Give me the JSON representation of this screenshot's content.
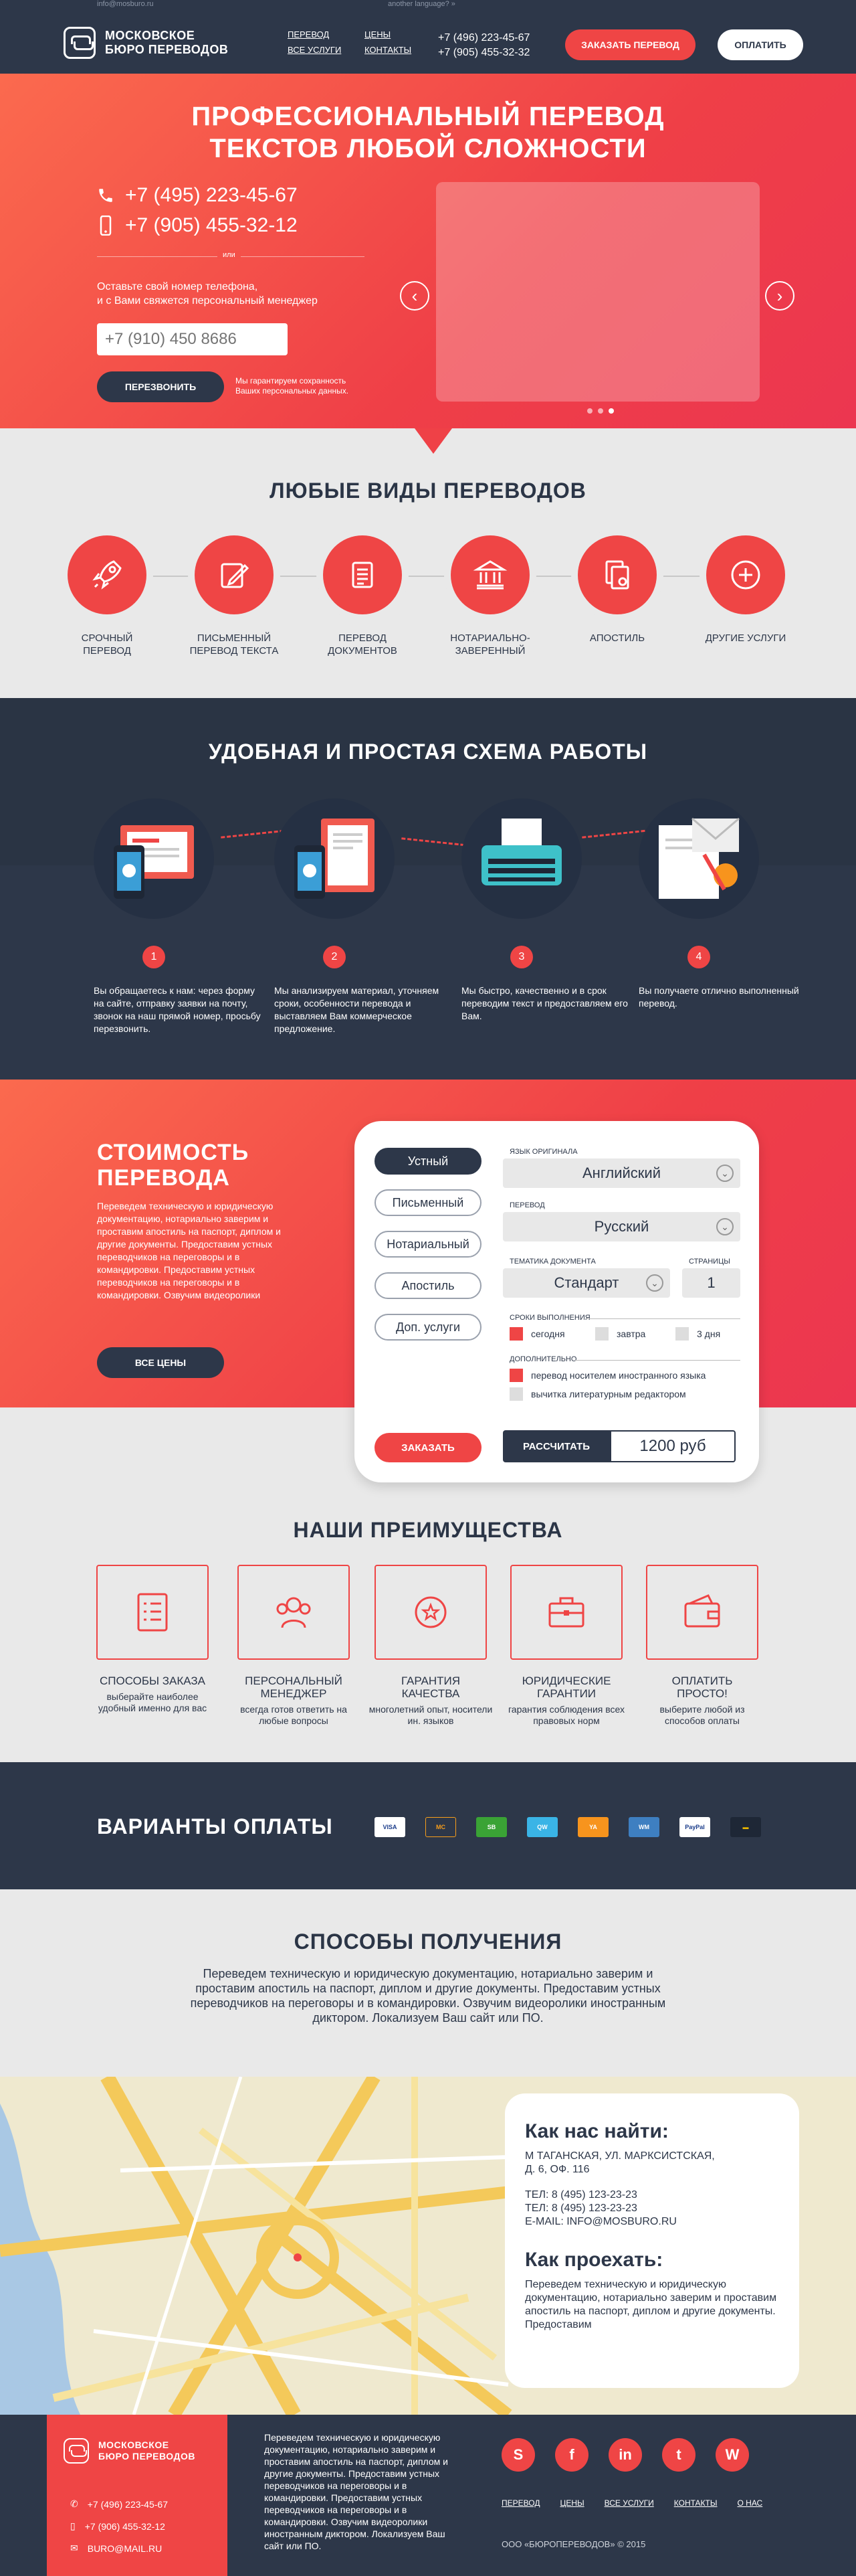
{
  "header": {
    "top_email": "info@mosburo.ru",
    "top_lang": "another language? »",
    "logo_line1": "МОСКОВСКОЕ",
    "logo_line2": "БЮРО ПЕРЕВОДОВ",
    "nav": [
      "ПЕРЕВОД",
      "ЦЕНЫ",
      "ВСЕ УСЛУГИ",
      "КОНТАКТЫ"
    ],
    "phone1": "+7 (496) 223-45-67",
    "phone2": "+7 (905) 455-32-32",
    "order_button": "ЗАКАЗАТЬ ПЕРЕВОД",
    "pay_button": "ОПЛАТИТЬ"
  },
  "hero": {
    "title_line1": "ПРОФЕССИОНАЛЬНЫЙ ПЕРЕВОД",
    "title_line2": "ТЕКСТОВ ЛЮБОЙ СЛОЖНОСТИ",
    "phone1": "+7 (495) 223-45-67",
    "phone2": "+7 (905) 455-32-12",
    "or_label": "или",
    "note_line1": "Оставьте свой номер телефона,",
    "note_line2": "и с Вами свяжется персональный менеджер",
    "phone_placeholder": "+7 (910) 450 8686",
    "call_button": "ПЕРЕЗВОНИТЬ",
    "privacy_line1": "Мы гарантируем сохранность",
    "privacy_line2": "Ваших персональных данных."
  },
  "services": {
    "title": "ЛЮБЫЕ ВИДЫ ПЕРЕВОДОВ",
    "items": [
      {
        "l1": "СРОЧНЫЙ",
        "l2": "ПЕРЕВОД",
        "icon": "rocket-icon"
      },
      {
        "l1": "ПИСЬМЕННЫЙ",
        "l2": "ПЕРЕВОД ТЕКСТА",
        "icon": "pen-document-icon"
      },
      {
        "l1": "ПЕРЕВОД",
        "l2": "ДОКУМЕНТОВ",
        "icon": "document-icon"
      },
      {
        "l1": "НОТАРИАЛЬНО-",
        "l2": "ЗАВЕРЕННЫЙ",
        "icon": "courthouse-icon"
      },
      {
        "l1": "АПОСТИЛЬ",
        "l2": "",
        "icon": "stamped-papers-icon"
      },
      {
        "l1": "ДРУГИЕ УСЛУГИ",
        "l2": "",
        "icon": "plus-circle-icon"
      }
    ]
  },
  "scheme": {
    "title": "УДОБНАЯ И ПРОСТАЯ СХЕМА РАБОТЫ",
    "steps": [
      {
        "num": "1",
        "text": "Вы обращаетесь к нам: через форму на сайте, отправку заявки на почту, звонок на наш прямой номер, просьбу перезвонить."
      },
      {
        "num": "2",
        "text": "Мы анализируем материал, уточняем сроки, особенности перевода и выставляем Вам коммерческое предложение."
      },
      {
        "num": "3",
        "text": "Мы быстро, качественно и в срок переводим текст и предоставляем его Вам."
      },
      {
        "num": "4",
        "text": "Вы получаете отлично выполненный перевод."
      }
    ]
  },
  "price": {
    "title_line1": "СТОИМОСТЬ",
    "title_line2": "ПЕРЕВОДА",
    "text": "Переведем техническую и юридическую документацию, нотариально заверим и проставим апостиль на паспорт, диплом и другие документы. Предоставим устных переводчиков на переговоры и в командировки. Предоставим устных переводчиков на переговоры и в командировки. Озвучим видеоролики",
    "all_prices_button": "ВСЕ ЦЕНЫ"
  },
  "calc": {
    "types": [
      "Устный",
      "Письменный",
      "Нотариальный",
      "Апостиль",
      "Доп. услуги"
    ],
    "source_lang_label": "ЯЗЫК ОРИГИНАЛА",
    "source_lang": "Английский",
    "target_lang_label": "ПЕРЕВОД",
    "target_lang": "Русский",
    "doc_type_label": "ТЕМАТИКА ДОКУМЕНТА",
    "doc_type": "Стандарт",
    "pages_label": "СТРАНИЦЫ",
    "pages": "1",
    "terms_label": "СРОКИ ВЫПОЛНЕНИЯ",
    "terms": [
      "сегодня",
      "завтра",
      "3 дня"
    ],
    "extra_label": "ДОПОЛНИТЕЛЬНО",
    "extras": [
      "перевод носителем иностранного языка",
      "вычитка литературным редактором"
    ],
    "order_button": "ЗАКАЗАТЬ",
    "calc_button": "РАССЧИТАТЬ",
    "sum": "1200 руб"
  },
  "advantages": {
    "title": "НАШИ ПРЕИМУЩЕСТВА",
    "items": [
      {
        "h1": "СПОСОБЫ ЗАКАЗА",
        "h2": "",
        "d": "выберайте наиболее удобный именно для вас",
        "icon": "checklist-icon"
      },
      {
        "h1": "ПЕРСОНАЛЬНЫЙ",
        "h2": "МЕНЕДЖЕР",
        "d": "всегда готов ответить на любые вопросы",
        "icon": "people-icon"
      },
      {
        "h1": "ГАРАНТИЯ",
        "h2": "КАЧЕСТВА",
        "d": "многолетний опыт, носители ин. языков",
        "icon": "star-badge-icon"
      },
      {
        "h1": "ЮРИДИЧЕСКИЕ",
        "h2": "ГАРАНТИИ",
        "d": "гарантия соблюдения всех правовых норм",
        "icon": "briefcase-icon"
      },
      {
        "h1": "ОПЛАТИТЬ",
        "h2": "ПРОСТО!",
        "d": "выберите любой из способов оплаты",
        "icon": "wallet-icon"
      }
    ]
  },
  "payment": {
    "title": "ВАРИАНТЫ ОПЛАТЫ",
    "methods": [
      {
        "label": "VISA",
        "color": "#ffffff",
        "fg": "#1a3c8a"
      },
      {
        "label": "MC",
        "color": "#2d3749",
        "fg": "#f79e1b"
      },
      {
        "label": "SB",
        "color": "#2d3749",
        "fg": "#3aa335"
      },
      {
        "label": "QW",
        "color": "#2d3749",
        "fg": "#ffb300"
      },
      {
        "label": "YA",
        "color": "#2d3749",
        "fg": "#f7941d"
      },
      {
        "label": "WM",
        "color": "#2d3749",
        "fg": "#3e7fc1"
      },
      {
        "label": "PayPal",
        "color": "#ffffff",
        "fg": "#1a3c8a"
      },
      {
        "label": "▬",
        "color": "#2d3749",
        "fg": "#e6b400"
      }
    ]
  },
  "delivery": {
    "title": "СПОСОБЫ ПОЛУЧЕНИЯ",
    "text": "Переведем техническую и юридическую документацию, нотариально заверим и проставим апостиль на паспорт, диплом и другие документы. Предоставим устных переводчиков на переговоры и в командировки. Озвучим видеоролики иностранным диктором. Локализуем Ваш сайт или ПО."
  },
  "map": {
    "find_title": "Как нас найти:",
    "addr1": "М ТАГАНСКАЯ, УЛ. МАРКСИСТСКАЯ,",
    "addr2": "Д. 6, ОФ. 116",
    "tel1": "ТЕЛ: 8 (495) 123-23-23",
    "tel2": "ТЕЛ: 8 (495) 123-23-23",
    "email": "E-MAIL: INFO@MOSBURO.RU",
    "route_title": "Как проехать:",
    "route_text": "Переведем техническую и юридическую документацию, нотариально заверим и проставим апостиль на паспорт, диплом и другие документы. Предоставим"
  },
  "footer": {
    "logo_line1": "МОСКОВСКОЕ",
    "logo_line2": "БЮРО ПЕРЕВОДОВ",
    "phone1": "+7 (496) 223-45-67",
    "phone2": "+7 (906) 455-32-12",
    "email": "BURO@MAIL.RU",
    "about": "Переведем техническую и юридическую документацию, нотариально заверим и проставим апостиль на паспорт, диплом и другие документы. Предоставим устных переводчиков на переговоры и в командировки. Предоставим устных переводчиков на переговоры и в командировки. Озвучим видеоролики иностранным диктором. Локализуем Ваш сайт или ПО.",
    "social": [
      "S",
      "f",
      "in",
      "t",
      "W"
    ],
    "nav": [
      "ПЕРЕВОД",
      "ЦЕНЫ",
      "ВСЕ УСЛУГИ",
      "КОНТАКТЫ",
      "О НАС"
    ],
    "copyright": "ООО «БЮРОПЕРЕВОДОВ» © 2015"
  }
}
